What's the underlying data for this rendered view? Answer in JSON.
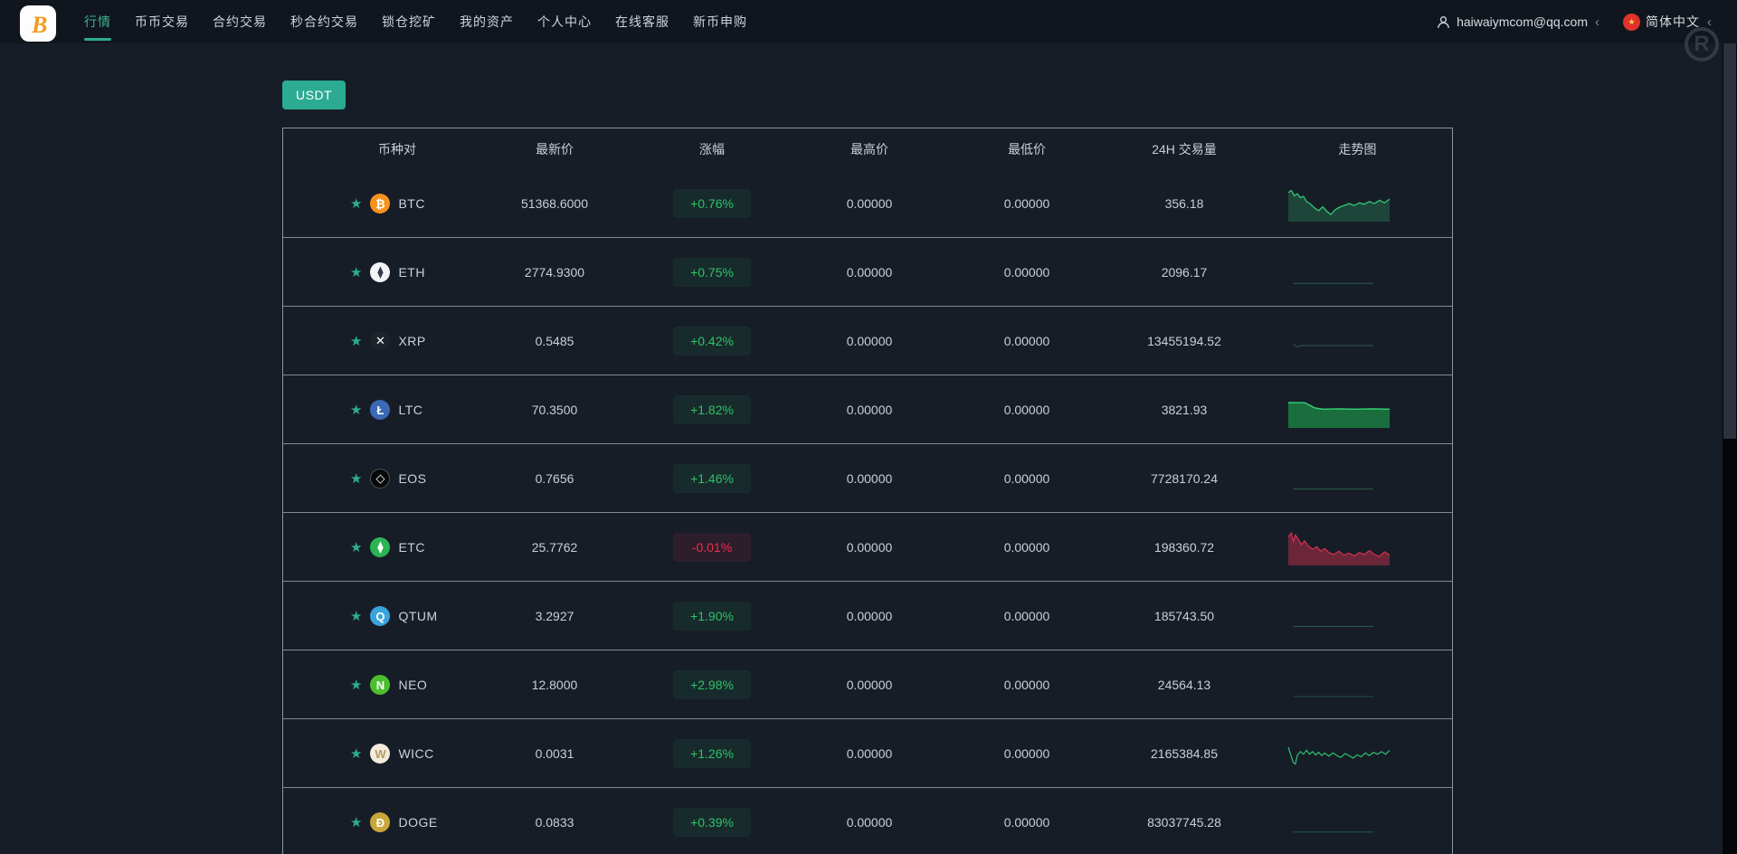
{
  "header": {
    "logo_letter": "B",
    "nav": [
      {
        "label": "行情",
        "active": true
      },
      {
        "label": "币币交易",
        "active": false
      },
      {
        "label": "合约交易",
        "active": false
      },
      {
        "label": "秒合约交易",
        "active": false
      },
      {
        "label": "锁仓挖矿",
        "active": false
      },
      {
        "label": "我的资产",
        "active": false
      },
      {
        "label": "个人中心",
        "active": false
      },
      {
        "label": "在线客服",
        "active": false
      },
      {
        "label": "新币申购",
        "active": false
      }
    ],
    "account": {
      "email": "haiwaiymcom@qq.com",
      "chevron": "‹"
    },
    "language": {
      "label": "简体中文",
      "chevron": "‹",
      "flag_star": "★"
    },
    "watermark_letter": "R"
  },
  "filters": {
    "usdt_tab": "USDT"
  },
  "colors": {
    "accent": "#2ead90",
    "up": "#2dc268",
    "down": "#ef2b4b",
    "background": "#171d27",
    "header_bg": "#11161e",
    "divider": "#7f8894"
  },
  "market_table": {
    "columns": [
      "币种对",
      "最新价",
      "涨幅",
      "最高价",
      "最低价",
      "24H 交易量",
      "走势图"
    ],
    "rows": [
      {
        "symbol": "BTC",
        "price": "51368.6000",
        "change": "+0.76%",
        "direction": "up",
        "high": "0.00000",
        "low": "0.00000",
        "volume": "356.18",
        "icon": {
          "glyph": "₿",
          "bg": "#f7931a",
          "fg": "#ffffff"
        },
        "spark": {
          "color": "#2fbf71",
          "width": 1.4,
          "fill": "rgba(47,191,113,0.25)",
          "points": [
            [
              0,
              0.16
            ],
            [
              0.03,
              0.1
            ],
            [
              0.06,
              0.26
            ],
            [
              0.09,
              0.2
            ],
            [
              0.12,
              0.32
            ],
            [
              0.15,
              0.28
            ],
            [
              0.18,
              0.44
            ],
            [
              0.22,
              0.52
            ],
            [
              0.26,
              0.64
            ],
            [
              0.3,
              0.72
            ],
            [
              0.34,
              0.6
            ],
            [
              0.38,
              0.74
            ],
            [
              0.42,
              0.84
            ],
            [
              0.46,
              0.7
            ],
            [
              0.5,
              0.62
            ],
            [
              0.55,
              0.56
            ],
            [
              0.6,
              0.5
            ],
            [
              0.65,
              0.56
            ],
            [
              0.7,
              0.48
            ],
            [
              0.75,
              0.52
            ],
            [
              0.8,
              0.44
            ],
            [
              0.85,
              0.5
            ],
            [
              0.9,
              0.4
            ],
            [
              0.95,
              0.48
            ],
            [
              1,
              0.36
            ]
          ]
        }
      },
      {
        "symbol": "ETH",
        "price": "2774.9300",
        "change": "+0.75%",
        "direction": "up",
        "high": "0.00000",
        "low": "0.00000",
        "volume": "2096.17",
        "icon": {
          "glyph": "⧫",
          "bg": "#f2f4f7",
          "fg": "#33394a"
        },
        "spark": {
          "color": "rgba(47,152,98,0.55)",
          "width": 1,
          "points": [
            [
              0.05,
              0.84
            ],
            [
              0.84,
              0.84
            ]
          ]
        }
      },
      {
        "symbol": "XRP",
        "price": "0.5485",
        "change": "+0.42%",
        "direction": "up",
        "high": "0.00000",
        "low": "0.00000",
        "volume": "13455194.52",
        "icon": {
          "glyph": "✕",
          "bg": "#1d232b",
          "fg": "#ffffff"
        },
        "spark": {
          "color": "rgba(47,152,98,0.50)",
          "width": 1,
          "points": [
            [
              0.05,
              0.6
            ],
            [
              0.09,
              0.68
            ],
            [
              0.13,
              0.64
            ],
            [
              0.84,
              0.64
            ]
          ]
        }
      },
      {
        "symbol": "LTC",
        "price": "70.3500",
        "change": "+1.82%",
        "direction": "up",
        "high": "0.00000",
        "low": "0.00000",
        "volume": "3821.93",
        "icon": {
          "glyph": "Ł",
          "bg": "#3b69b5",
          "fg": "#ffffff"
        },
        "spark": {
          "color": "#35d477",
          "width": 1.4,
          "fill": "rgba(27,125,66,0.85)",
          "points": [
            [
              0,
              0.28
            ],
            [
              0.16,
              0.28
            ],
            [
              0.2,
              0.34
            ],
            [
              0.26,
              0.44
            ],
            [
              0.34,
              0.48
            ],
            [
              0.5,
              0.47
            ],
            [
              0.66,
              0.48
            ],
            [
              0.82,
              0.47
            ],
            [
              1,
              0.48
            ]
          ]
        }
      },
      {
        "symbol": "EOS",
        "price": "0.7656",
        "change": "+1.46%",
        "direction": "up",
        "high": "0.00000",
        "low": "0.00000",
        "volume": "7728170.24",
        "icon": {
          "glyph": "◇",
          "bg": "#07080a",
          "fg": "#ffffff"
        },
        "spark": {
          "color": "rgba(47,152,98,0.50)",
          "width": 1,
          "points": [
            [
              0.05,
              0.82
            ],
            [
              0.84,
              0.82
            ]
          ]
        }
      },
      {
        "symbol": "ETC",
        "price": "25.7762",
        "change": "-0.01%",
        "direction": "down",
        "high": "0.00000",
        "low": "0.00000",
        "volume": "198360.72",
        "icon": {
          "glyph": "⧫",
          "bg": "#2ab552",
          "fg": "#ffffff"
        },
        "spark": {
          "color": "#d2344f",
          "width": 1.2,
          "fill": "rgba(210,52,79,0.45)",
          "points": [
            [
              0,
              0.18
            ],
            [
              0.03,
              0.06
            ],
            [
              0.05,
              0.32
            ],
            [
              0.07,
              0.12
            ],
            [
              0.1,
              0.26
            ],
            [
              0.13,
              0.42
            ],
            [
              0.16,
              0.3
            ],
            [
              0.2,
              0.46
            ],
            [
              0.24,
              0.56
            ],
            [
              0.28,
              0.48
            ],
            [
              0.32,
              0.62
            ],
            [
              0.36,
              0.54
            ],
            [
              0.4,
              0.66
            ],
            [
              0.45,
              0.72
            ],
            [
              0.5,
              0.62
            ],
            [
              0.55,
              0.74
            ],
            [
              0.6,
              0.68
            ],
            [
              0.65,
              0.76
            ],
            [
              0.7,
              0.66
            ],
            [
              0.75,
              0.72
            ],
            [
              0.8,
              0.6
            ],
            [
              0.85,
              0.72
            ],
            [
              0.9,
              0.78
            ],
            [
              0.95,
              0.64
            ],
            [
              1,
              0.74
            ]
          ]
        }
      },
      {
        "symbol": "QTUM",
        "price": "3.2927",
        "change": "+1.90%",
        "direction": "up",
        "high": "0.00000",
        "low": "0.00000",
        "volume": "185743.50",
        "icon": {
          "glyph": "Q",
          "bg": "#3aa3dc",
          "fg": "#ffffff"
        },
        "spark": {
          "color": "rgba(47,152,98,0.50)",
          "width": 1,
          "points": [
            [
              0.05,
              0.82
            ],
            [
              0.84,
              0.82
            ]
          ]
        }
      },
      {
        "symbol": "NEO",
        "price": "12.8000",
        "change": "+2.98%",
        "direction": "up",
        "high": "0.00000",
        "low": "0.00000",
        "volume": "24564.13",
        "icon": {
          "glyph": "N",
          "bg": "#4cbf2f",
          "fg": "#ffffff"
        },
        "spark": {
          "color": "rgba(47,152,98,0.40)",
          "width": 1,
          "points": [
            [
              0.05,
              0.86
            ],
            [
              0.84,
              0.86
            ]
          ]
        }
      },
      {
        "symbol": "WICC",
        "price": "0.0031",
        "change": "+1.26%",
        "direction": "up",
        "high": "0.00000",
        "low": "0.00000",
        "volume": "2165384.85",
        "icon": {
          "glyph": "W",
          "bg": "#f3ecdc",
          "fg": "#b89b5e"
        },
        "spark": {
          "color": "#2fbf71",
          "width": 1.2,
          "points": [
            [
              0,
              0.3
            ],
            [
              0.025,
              0.55
            ],
            [
              0.05,
              0.78
            ],
            [
              0.07,
              0.82
            ],
            [
              0.09,
              0.55
            ],
            [
              0.12,
              0.44
            ],
            [
              0.15,
              0.52
            ],
            [
              0.18,
              0.4
            ],
            [
              0.21,
              0.52
            ],
            [
              0.24,
              0.44
            ],
            [
              0.27,
              0.54
            ],
            [
              0.3,
              0.46
            ],
            [
              0.33,
              0.56
            ],
            [
              0.36,
              0.48
            ],
            [
              0.4,
              0.58
            ],
            [
              0.44,
              0.48
            ],
            [
              0.48,
              0.56
            ],
            [
              0.52,
              0.62
            ],
            [
              0.56,
              0.5
            ],
            [
              0.6,
              0.56
            ],
            [
              0.64,
              0.64
            ],
            [
              0.68,
              0.54
            ],
            [
              0.72,
              0.6
            ],
            [
              0.76,
              0.48
            ],
            [
              0.8,
              0.56
            ],
            [
              0.84,
              0.46
            ],
            [
              0.88,
              0.52
            ],
            [
              0.92,
              0.44
            ],
            [
              0.96,
              0.52
            ],
            [
              1,
              0.4
            ]
          ]
        }
      },
      {
        "symbol": "DOGE",
        "price": "0.0833",
        "change": "+0.39%",
        "direction": "up",
        "high": "0.00000",
        "low": "0.00000",
        "volume": "83037745.28",
        "icon": {
          "glyph": "Đ",
          "bg": "#c9a63a",
          "fg": "#ffffff"
        },
        "spark": {
          "color": "rgba(47,152,98,0.50)",
          "width": 1,
          "points": [
            [
              0.05,
              0.8
            ],
            [
              0.84,
              0.8
            ]
          ]
        }
      }
    ]
  }
}
